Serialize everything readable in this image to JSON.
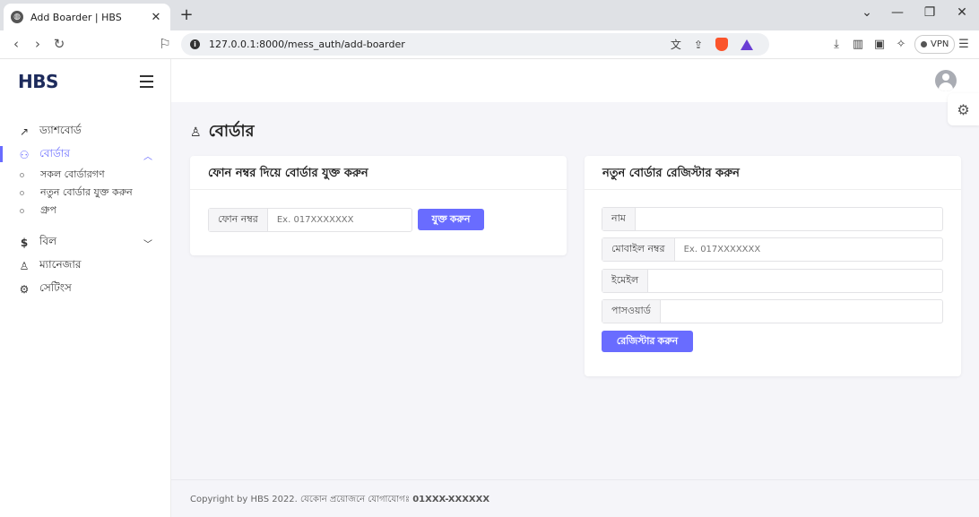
{
  "browser": {
    "tab_title": "Add Boarder | HBS",
    "url": "127.0.0.1:8000/mess_auth/add-boarder",
    "vpn_label": "VPN"
  },
  "sidebar": {
    "brand": "HBS",
    "items": [
      {
        "label": "ড্যাশবোর্ড",
        "icon": "trend-icon"
      },
      {
        "label": "বোর্ডার",
        "icon": "users-icon",
        "active": true
      },
      {
        "label": "বিল",
        "icon": "dollar-icon"
      },
      {
        "label": "ম্যানেজার",
        "icon": "user-check-icon"
      },
      {
        "label": "সেটিংস",
        "icon": "gear-icon"
      }
    ],
    "sub_items": [
      {
        "label": "সকল বোর্ডারগণ"
      },
      {
        "label": "নতুন বোর্ডার যুক্ত করুন"
      },
      {
        "label": "গ্রুপ"
      }
    ]
  },
  "main": {
    "page_title": "বোর্ডার",
    "phone_card": {
      "title": "ফোন নম্বর দিয়ে বোর্ডার যুক্ত করুন",
      "phone_label": "ফোন নম্বর",
      "phone_placeholder": "Ex. 017XXXXXXX",
      "add_button": "যুক্ত করুন"
    },
    "register_card": {
      "title": "নতুন বোর্ডার রেজিস্টার করুন",
      "name_label": "নাম",
      "mobile_label": "মোবাইল নম্বর",
      "mobile_placeholder": "Ex. 017XXXXXXX",
      "email_label": "ইমেইল",
      "password_label": "পাসওয়ার্ড",
      "register_button": "রেজিস্টার করুন"
    }
  },
  "footer": {
    "text": "Copyright by HBS 2022. যেকোন প্রয়োজনে যোগাযোগঃ ",
    "contact": "01XXX-XXXXXX"
  }
}
